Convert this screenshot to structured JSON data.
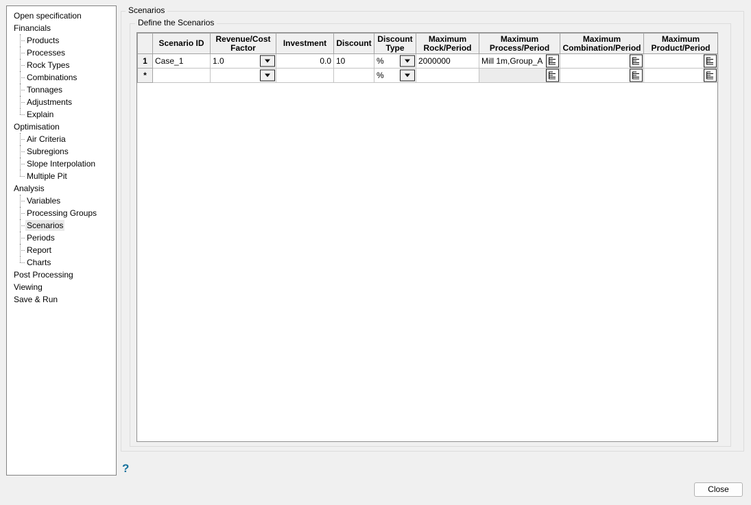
{
  "tree": {
    "items": [
      {
        "label": "Open specification"
      },
      {
        "label": "Financials"
      },
      {
        "label": "Products"
      },
      {
        "label": "Processes"
      },
      {
        "label": "Rock Types"
      },
      {
        "label": "Combinations"
      },
      {
        "label": "Tonnages"
      },
      {
        "label": "Adjustments"
      },
      {
        "label": "Explain"
      },
      {
        "label": "Optimisation"
      },
      {
        "label": "Air Criteria"
      },
      {
        "label": "Subregions"
      },
      {
        "label": "Slope Interpolation"
      },
      {
        "label": "Multiple Pit"
      },
      {
        "label": "Analysis"
      },
      {
        "label": "Variables"
      },
      {
        "label": "Processing Groups"
      },
      {
        "label": "Scenarios"
      },
      {
        "label": "Periods"
      },
      {
        "label": "Report"
      },
      {
        "label": "Charts"
      },
      {
        "label": "Post Processing"
      },
      {
        "label": "Viewing"
      },
      {
        "label": "Save & Run"
      }
    ],
    "selected_item": "Scenarios"
  },
  "groups": {
    "outer_label": "Scenarios",
    "inner_label": "Define the Scenarios"
  },
  "table": {
    "headers": {
      "corner": "",
      "scenario_id": "Scenario ID",
      "revenue_cost": "Revenue/Cost\nFactor",
      "investment": "Investment",
      "discount": "Discount",
      "discount_type": "Discount\nType",
      "max_rock": "Maximum\nRock/Period",
      "max_process": "Maximum\nProcess/Period",
      "max_combination": "Maximum\nCombination/Period",
      "max_product": "Maximum\nProduct/Period"
    },
    "row1": {
      "row_header": "1",
      "scenario_id": "Case_1",
      "revenue_cost": "1.0",
      "investment": "0.0",
      "discount": "10",
      "discount_type": "%",
      "max_rock": "2000000",
      "max_process": "Mill 1m,Group_A",
      "max_combination": "",
      "max_product": ""
    },
    "new_row": {
      "row_header": "*",
      "scenario_id": "",
      "revenue_cost": "",
      "investment": "",
      "discount": "",
      "discount_type": "%",
      "max_rock": "",
      "max_process": "",
      "max_combination": "",
      "max_product": ""
    }
  },
  "footer": {
    "help_label": "?",
    "close_label": "Close"
  },
  "colors": {
    "help_icon": "#17729e",
    "window_background": "#f0f0f0",
    "selected_tree_item": "#e9e9e9"
  }
}
